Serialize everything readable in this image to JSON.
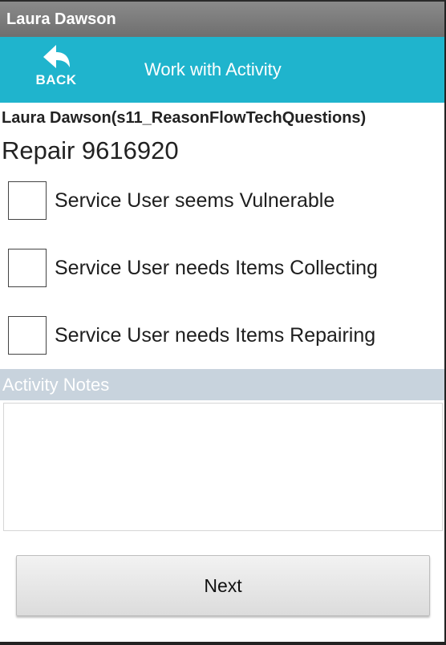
{
  "window": {
    "title": "Laura Dawson"
  },
  "header": {
    "back_label": "BACK",
    "back_icon": "back-arrow-icon",
    "title": "Work with Activity",
    "color": "#1fb4cd"
  },
  "job": {
    "person": "Laura Dawson(s11_ReasonFlowTechQuestions)",
    "repair": "Repair 9616920"
  },
  "checkboxes": [
    {
      "label": "Service User seems Vulnerable",
      "checked": false
    },
    {
      "label": "Service User needs Items Collecting",
      "checked": false
    },
    {
      "label": "Service User needs Items Repairing",
      "checked": false
    }
  ],
  "notes": {
    "header": "Activity Notes",
    "value": ""
  },
  "footer": {
    "next_label": "Next"
  }
}
